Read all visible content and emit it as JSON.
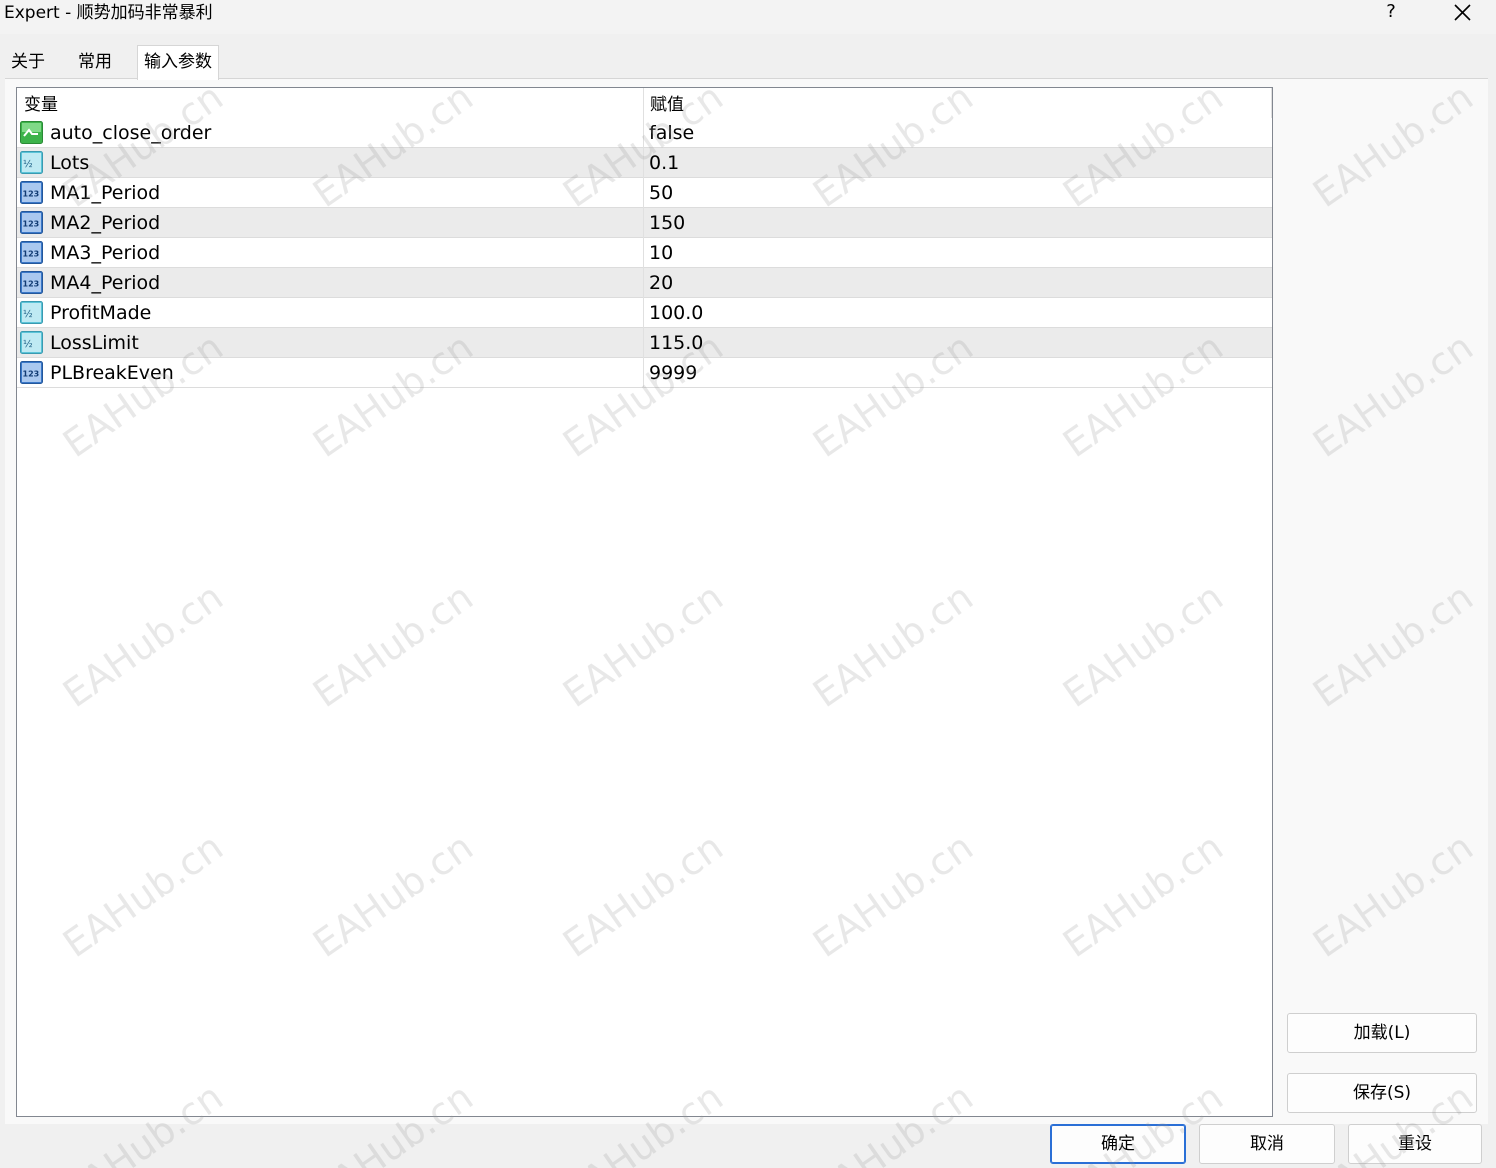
{
  "window": {
    "title": "Expert - 顺势加码非常暴利",
    "help_label": "?"
  },
  "tabs": [
    {
      "label": "关于"
    },
    {
      "label": "常用"
    },
    {
      "label": "输入参数"
    }
  ],
  "grid": {
    "headers": {
      "variable": "变量",
      "value": "赋值"
    },
    "rows": [
      {
        "name": "auto_close_order",
        "value": "false",
        "icon": "bool-icon"
      },
      {
        "name": "Lots",
        "value": "0.1",
        "icon": "double-icon"
      },
      {
        "name": "MA1_Period",
        "value": "50",
        "icon": "int-icon"
      },
      {
        "name": "MA2_Period",
        "value": "150",
        "icon": "int-icon"
      },
      {
        "name": "MA3_Period",
        "value": "10",
        "icon": "int-icon"
      },
      {
        "name": "MA4_Period",
        "value": "20",
        "icon": "int-icon"
      },
      {
        "name": "ProfitMade",
        "value": "100.0",
        "icon": "double-icon"
      },
      {
        "name": "LossLimit",
        "value": "115.0",
        "icon": "double-icon"
      },
      {
        "name": "PLBreakEven",
        "value": "9999",
        "icon": "int-icon"
      }
    ]
  },
  "side_buttons": {
    "load": "加载(L)",
    "save": "保存(S)"
  },
  "footer_buttons": {
    "ok": "确定",
    "cancel": "取消",
    "reset": "重设"
  },
  "watermark": "EAHub.cn"
}
